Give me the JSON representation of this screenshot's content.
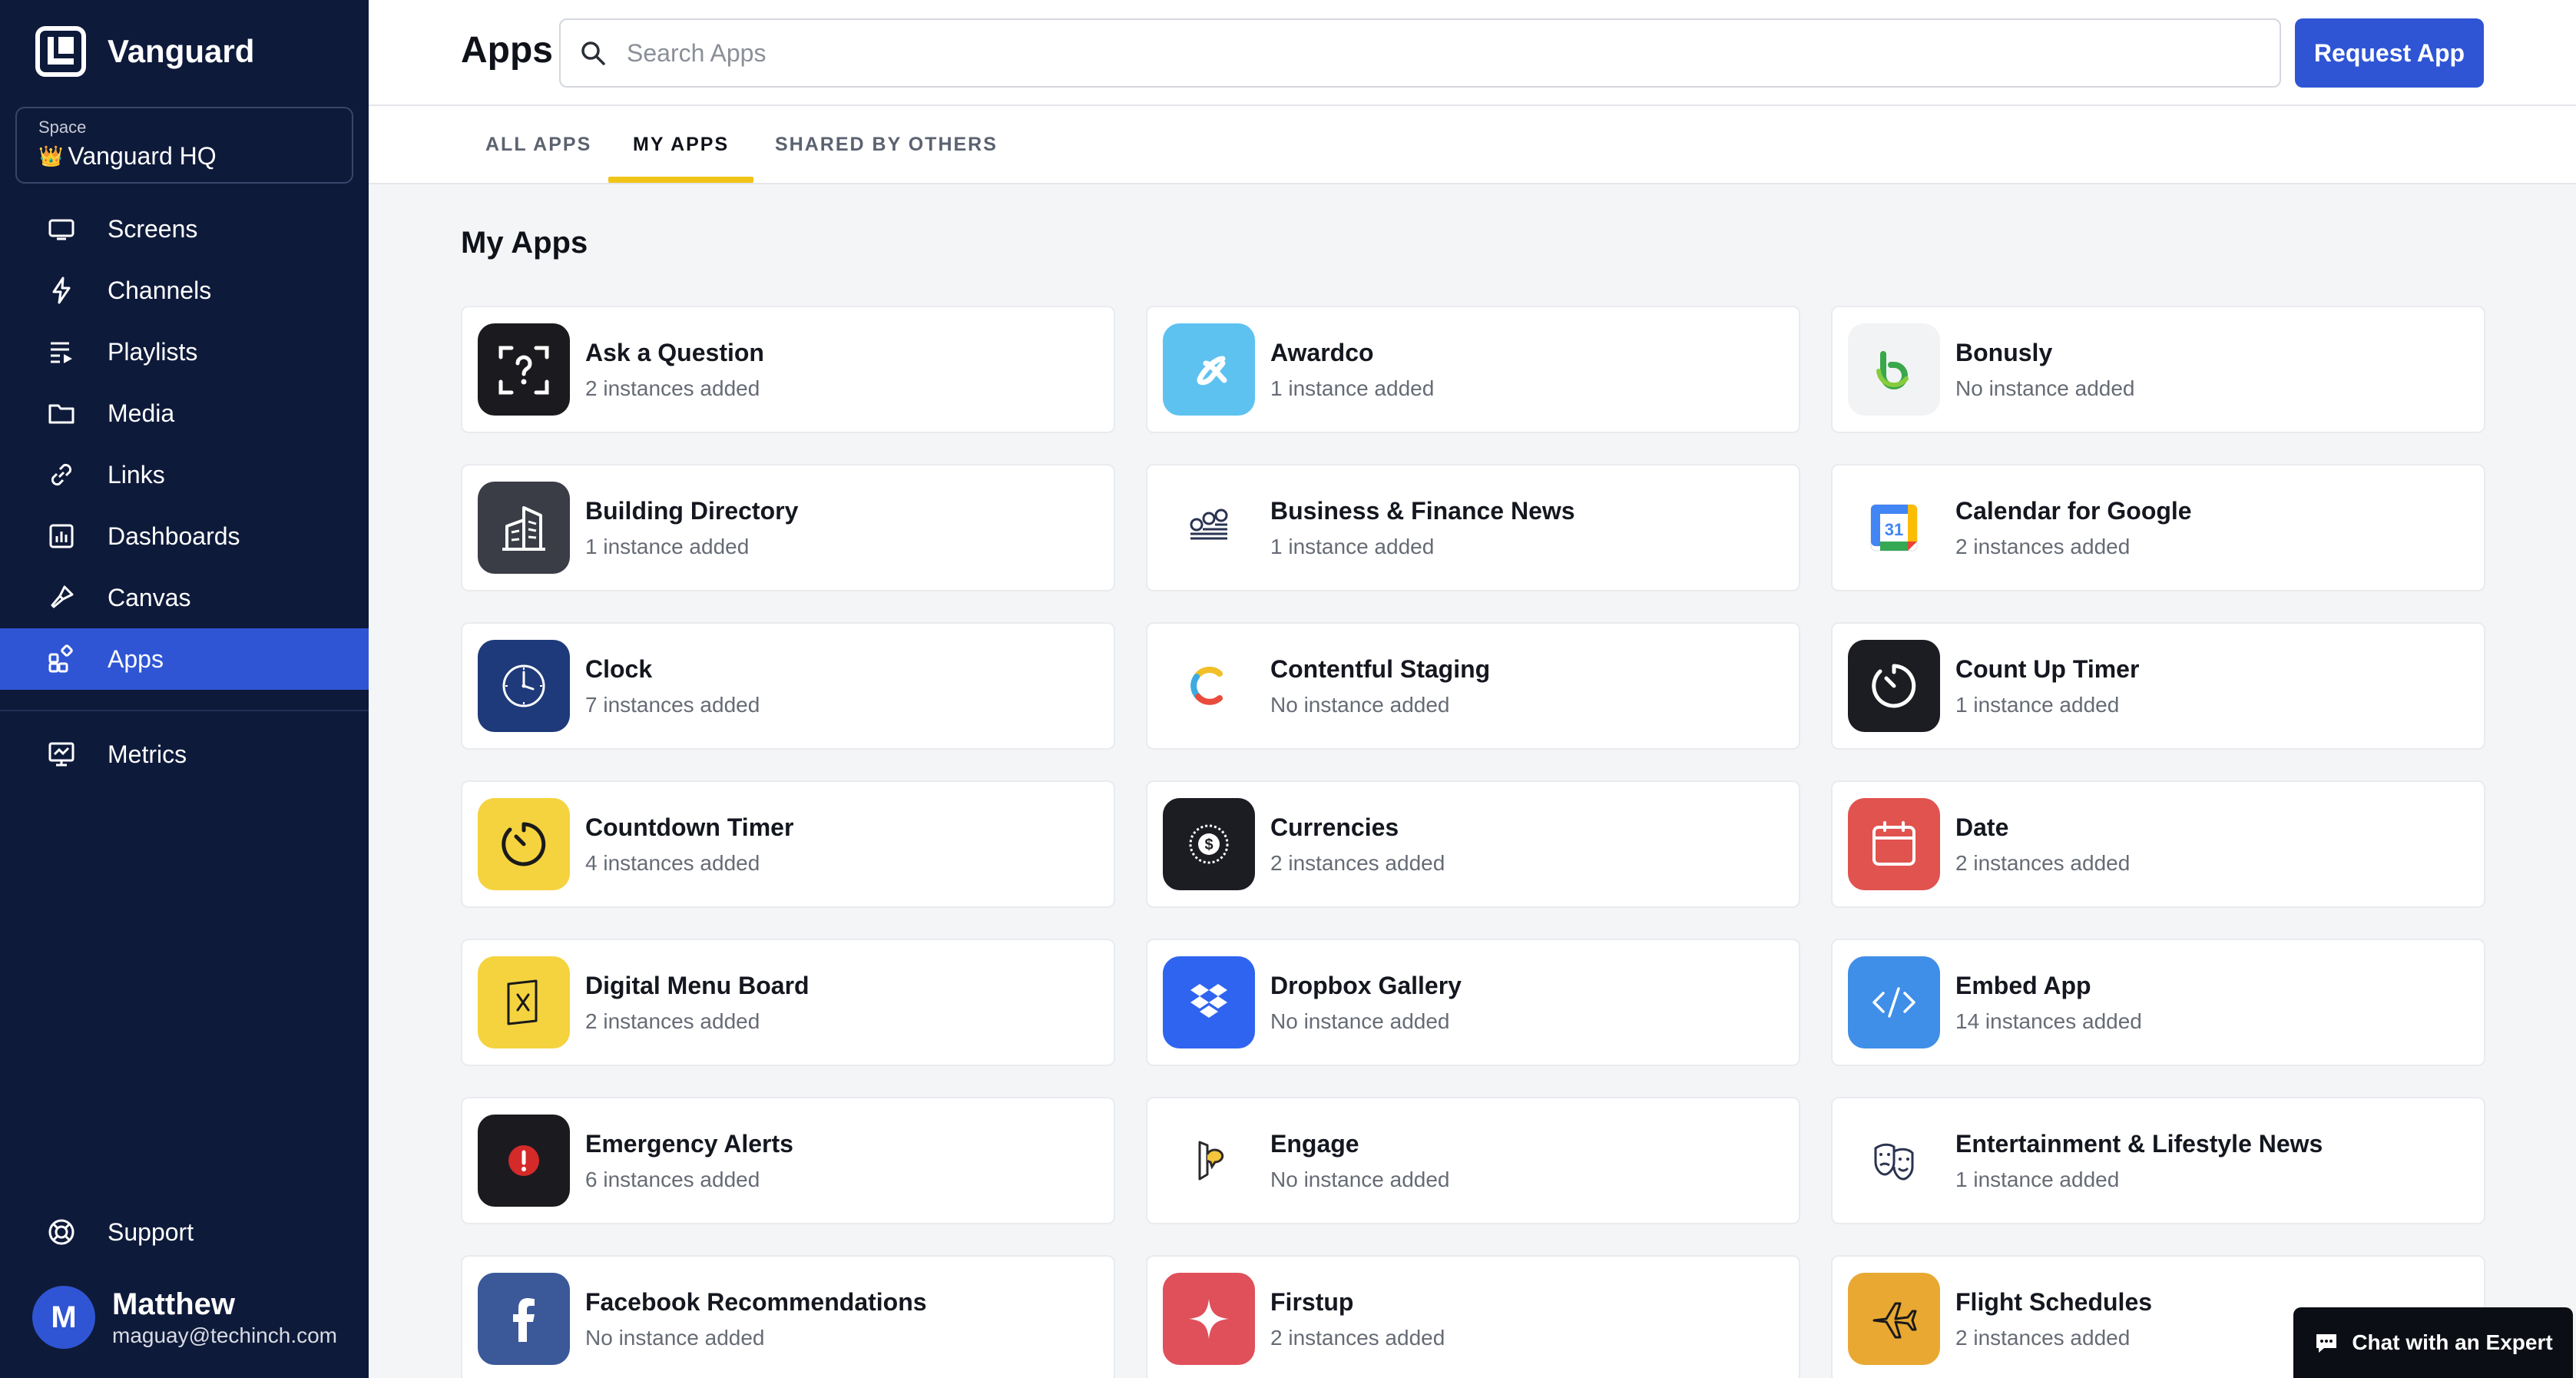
{
  "brand": {
    "name": "Vanguard"
  },
  "space": {
    "label": "Space",
    "name": "Vanguard HQ"
  },
  "nav": {
    "items": [
      {
        "label": "Screens",
        "icon": "screen-icon"
      },
      {
        "label": "Channels",
        "icon": "bolt-icon"
      },
      {
        "label": "Playlists",
        "icon": "playlist-icon"
      },
      {
        "label": "Media",
        "icon": "folder-icon"
      },
      {
        "label": "Links",
        "icon": "link-icon"
      },
      {
        "label": "Dashboards",
        "icon": "dashboard-icon"
      },
      {
        "label": "Canvas",
        "icon": "brush-icon"
      },
      {
        "label": "Apps",
        "icon": "apps-icon",
        "active": true
      }
    ],
    "metrics": "Metrics",
    "support": "Support"
  },
  "user": {
    "initial": "M",
    "name": "Matthew",
    "email": "maguay@techinch.com"
  },
  "header": {
    "title": "Apps",
    "search_placeholder": "Search Apps",
    "request_label": "Request App"
  },
  "tabs": [
    {
      "label": "ALL APPS"
    },
    {
      "label": "MY APPS",
      "active": true
    },
    {
      "label": "SHARED BY OTHERS"
    }
  ],
  "section_title": "My Apps",
  "apps": [
    {
      "name": "Ask a Question",
      "count": "2 instances added",
      "icon": "question-scan-icon",
      "color": "#1b1b1f"
    },
    {
      "name": "Awardco",
      "count": "1 instance added",
      "icon": "awardco-logo-icon",
      "color": "#5ec2f0"
    },
    {
      "name": "Bonusly",
      "count": "No instance added",
      "icon": "bonusly-logo-icon",
      "color": "#f2f3f5"
    },
    {
      "name": "Building Directory",
      "count": "1 instance added",
      "icon": "building-icon",
      "color": "#3a3d46"
    },
    {
      "name": "Business & Finance News",
      "count": "1 instance added",
      "icon": "coins-chart-icon",
      "color": "#ffffff"
    },
    {
      "name": "Calendar for Google",
      "count": "2 instances added",
      "icon": "google-calendar-icon",
      "color": "#ffffff"
    },
    {
      "name": "Clock",
      "count": "7 instances added",
      "icon": "clock-icon",
      "color": "#1e3a7a"
    },
    {
      "name": "Contentful Staging",
      "count": "No instance added",
      "icon": "contentful-logo-icon",
      "color": "#ffffff"
    },
    {
      "name": "Count Up Timer",
      "count": "1 instance added",
      "icon": "timer-icon",
      "color": "#1c1d22"
    },
    {
      "name": "Countdown Timer",
      "count": "4 instances added",
      "icon": "countdown-icon",
      "color": "#f5d33f"
    },
    {
      "name": "Currencies",
      "count": "2 instances added",
      "icon": "currency-coin-icon",
      "color": "#1c1d22"
    },
    {
      "name": "Date",
      "count": "2 instances added",
      "icon": "calendar-icon",
      "color": "#e0534f"
    },
    {
      "name": "Digital Menu Board",
      "count": "2 instances added",
      "icon": "menu-board-icon",
      "color": "#f5d33f"
    },
    {
      "name": "Dropbox Gallery",
      "count": "No instance added",
      "icon": "dropbox-logo-icon",
      "color": "#2f64f0"
    },
    {
      "name": "Embed App",
      "count": "14 instances added",
      "icon": "code-icon",
      "color": "#3f8ee8"
    },
    {
      "name": "Emergency Alerts",
      "count": "6 instances added",
      "icon": "alert-icon",
      "color": "#1b1b1f"
    },
    {
      "name": "Engage",
      "count": "No instance added",
      "icon": "engage-icon",
      "color": "#ffffff"
    },
    {
      "name": "Entertainment & Lifestyle News",
      "count": "1 instance added",
      "icon": "theater-masks-icon",
      "color": "#ffffff"
    },
    {
      "name": "Facebook Recommendations",
      "count": "No instance added",
      "icon": "facebook-logo-icon",
      "color": "#3b5998"
    },
    {
      "name": "Firstup",
      "count": "2 instances added",
      "icon": "firstup-logo-icon",
      "color": "#e0505a"
    },
    {
      "name": "Flight Schedules",
      "count": "2 instances added",
      "icon": "airplane-icon",
      "color": "#e8a832"
    }
  ],
  "chat": {
    "label": "Chat with an Expert"
  }
}
